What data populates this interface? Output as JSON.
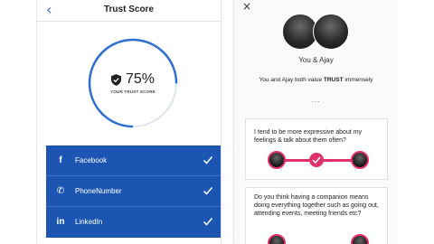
{
  "left_screen": {
    "header": {
      "back_glyph": "‹",
      "title": "Trust Score"
    },
    "score": {
      "value": "75%",
      "fraction": 0.75,
      "label": "YOUR TRUST SCORE",
      "icon": "shield-check-icon"
    },
    "accounts": [
      {
        "name": "Facebook",
        "icon": "facebook-icon",
        "glyph": "f",
        "verified": true
      },
      {
        "name": "PhoneNumber",
        "icon": "phone-icon",
        "glyph": "✆",
        "verified": true
      },
      {
        "name": "LinkedIn",
        "icon": "linkedin-icon",
        "glyph": "in",
        "verified": true
      }
    ],
    "colors": {
      "accent": "#1c56b2",
      "gauge": "#2f6fd0",
      "gauge_track": "#e0e6ee"
    }
  },
  "right_screen": {
    "close_glyph": "×",
    "match_names": "You & Ajay",
    "value_text_pre": "You and Ajay both value ",
    "value_text_em": "TRUST",
    "value_text_post": " immensely",
    "ellipsis": "...",
    "questions": [
      {
        "text": "I tend to be more expressive about my feelings & talk about them often?"
      },
      {
        "text": "Do you think having a companion means doing everything together such as going out, attending events, meeting friends etc?"
      }
    ],
    "colors": {
      "accent": "#e1306c"
    }
  }
}
